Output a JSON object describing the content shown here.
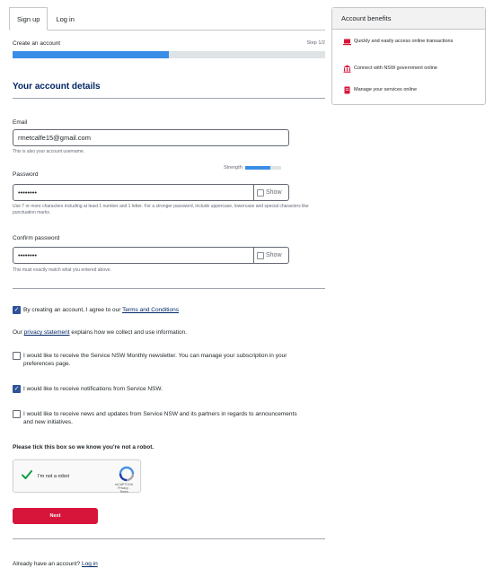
{
  "tabs": [
    {
      "label": "Sign up"
    },
    {
      "label": "Log in"
    }
  ],
  "progress": {
    "label": "Create an account",
    "step": "Step 1/2",
    "fraction": 0.5
  },
  "section": {
    "title": "Your account details"
  },
  "email": {
    "label": "Email",
    "value": "rmetcalfe15@gmail.com",
    "help": "This is also your account username."
  },
  "password": {
    "label": "Password",
    "value": "••••••••",
    "strength_label": "Strength",
    "strength_fraction": 0.7,
    "show_label": "Show",
    "help": "Use 7 or more characters including at least 1 number and 1 letter. For a stronger password, include uppercase, lowercase and special characters like punctuation marks."
  },
  "confirm": {
    "label": "Confirm password",
    "value": "••••••••",
    "show_label": "Show",
    "help": "This must exactly match what you entered above."
  },
  "terms": {
    "checked": true,
    "text": "By creating an account, I agree to our ",
    "link": "Terms and Conditions"
  },
  "privacy": {
    "prefix": "Our ",
    "link": "privacy statement",
    "suffix": " explains how we collect and use information."
  },
  "options": [
    {
      "checked": false,
      "text": "I would like to receive the Service NSW Monthly newsletter. You can manage your subscription in your preferences page."
    },
    {
      "checked": true,
      "text": "I would like to receive notifications from Service NSW."
    },
    {
      "checked": false,
      "text": "I would like to receive news and updates from Service NSW and its partners in regards to announcements and new initiatives."
    }
  ],
  "robot_prompt": "Please tick this box so we know you're not a robot.",
  "captcha": {
    "label": "I'm not a robot",
    "brand": "reCAPTCHA",
    "sub": "Privacy - Terms"
  },
  "next_button": "Next",
  "footer": {
    "prefix": "Already have an account? ",
    "link": "Log in"
  },
  "sidebar": {
    "title": "Account benefits",
    "items": [
      {
        "icon": "laptop-icon",
        "text": "Quickly and easily access online transactions"
      },
      {
        "icon": "government-building-icon",
        "text": "Connect with NSW government online"
      },
      {
        "icon": "document-icon",
        "text": "Manage your services online"
      }
    ]
  },
  "colors": {
    "accent_red": "#d7153a",
    "navy": "#002664",
    "progress_blue": "#3b8ee8",
    "checkbox_blue": "#2e5299"
  }
}
